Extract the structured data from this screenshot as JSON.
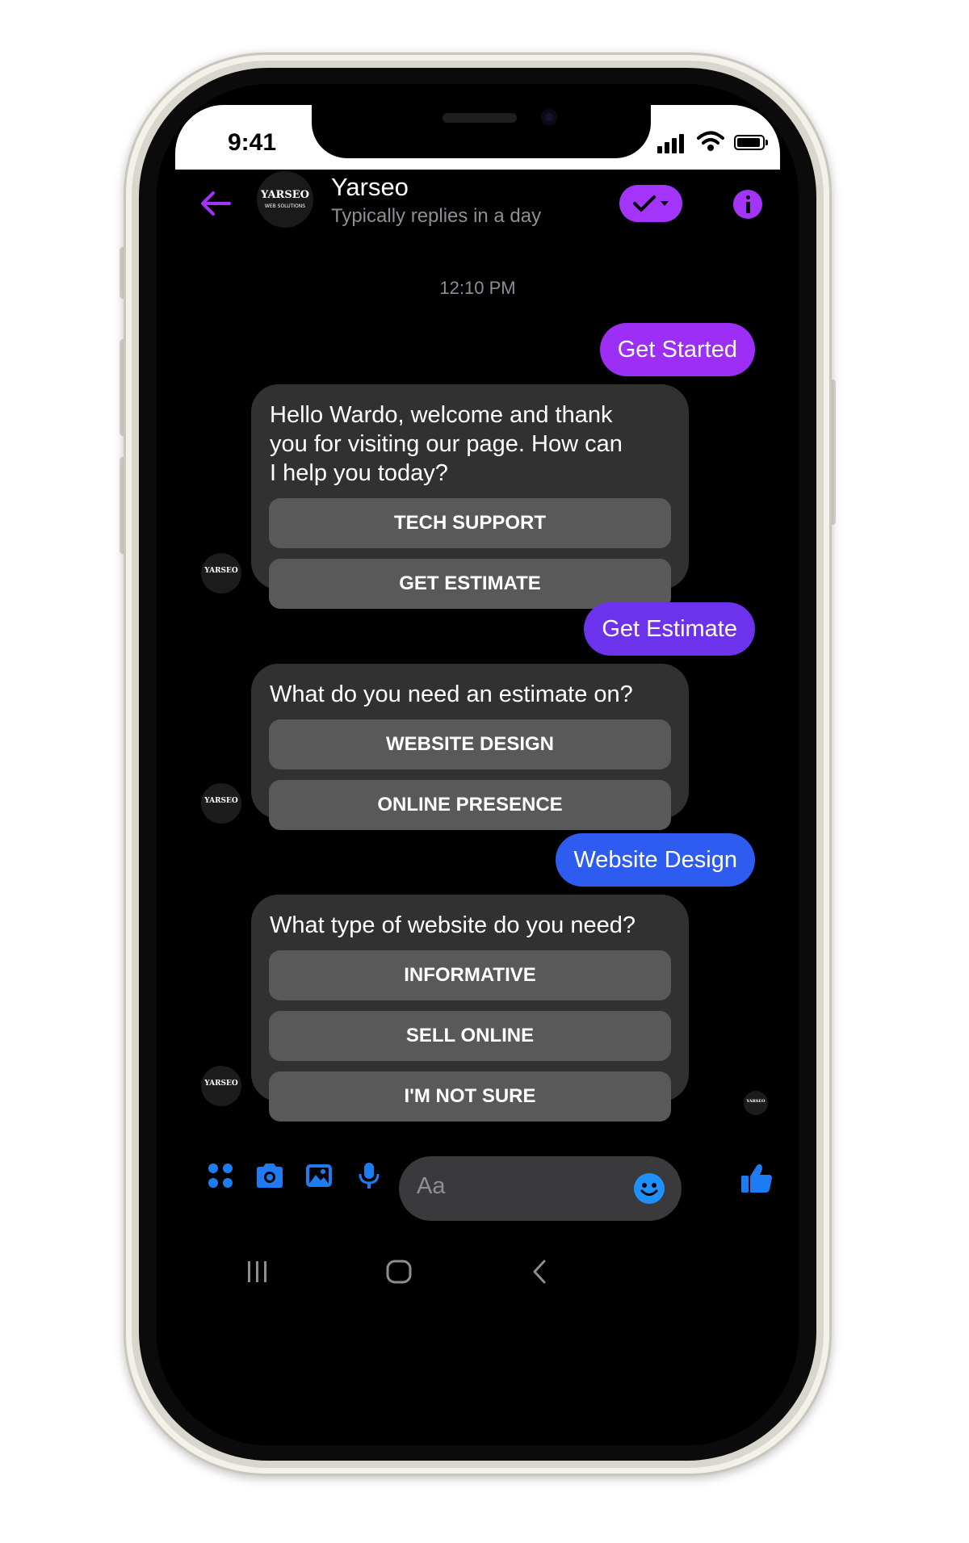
{
  "status_bar": {
    "time": "9:41"
  },
  "header": {
    "page_name": "Yarseo",
    "subtitle": "Typically replies in a day",
    "logo_text": "YARSEO",
    "logo_subtext": "WEB SOLUTIONS"
  },
  "conversation": {
    "timestamp": "12:10 PM",
    "messages": [
      {
        "type": "outgoing",
        "text": "Get Started",
        "color": "#9d2ef6"
      },
      {
        "type": "incoming",
        "text": "Hello Wardo, welcome and thank you for visiting our page. How can I help you today?",
        "quick_replies": [
          "TECH SUPPORT",
          "GET ESTIMATE"
        ]
      },
      {
        "type": "outgoing",
        "text": "Get Estimate",
        "color": "#6d33ec"
      },
      {
        "type": "incoming",
        "text": "What do you need an estimate on?",
        "quick_replies": [
          "WEBSITE DESIGN",
          "ONLINE PRESENCE"
        ]
      },
      {
        "type": "outgoing",
        "text": "Website Design",
        "color": "#2f5cf0"
      },
      {
        "type": "incoming",
        "text": "What type of website do you need?",
        "quick_replies": [
          "INFORMATIVE",
          "SELL ONLINE",
          "I'M NOT SURE"
        ]
      }
    ]
  },
  "composer": {
    "placeholder": "Aa",
    "icons": [
      "apps-icon",
      "camera-icon",
      "gallery-icon",
      "microphone-icon",
      "emoji-icon",
      "thumbs-up-icon"
    ]
  },
  "colors": {
    "accent_purple": "#a334fa",
    "messenger_blue": "#1e7cf2",
    "bubble_incoming": "#313131",
    "quick_reply": "#595959"
  }
}
